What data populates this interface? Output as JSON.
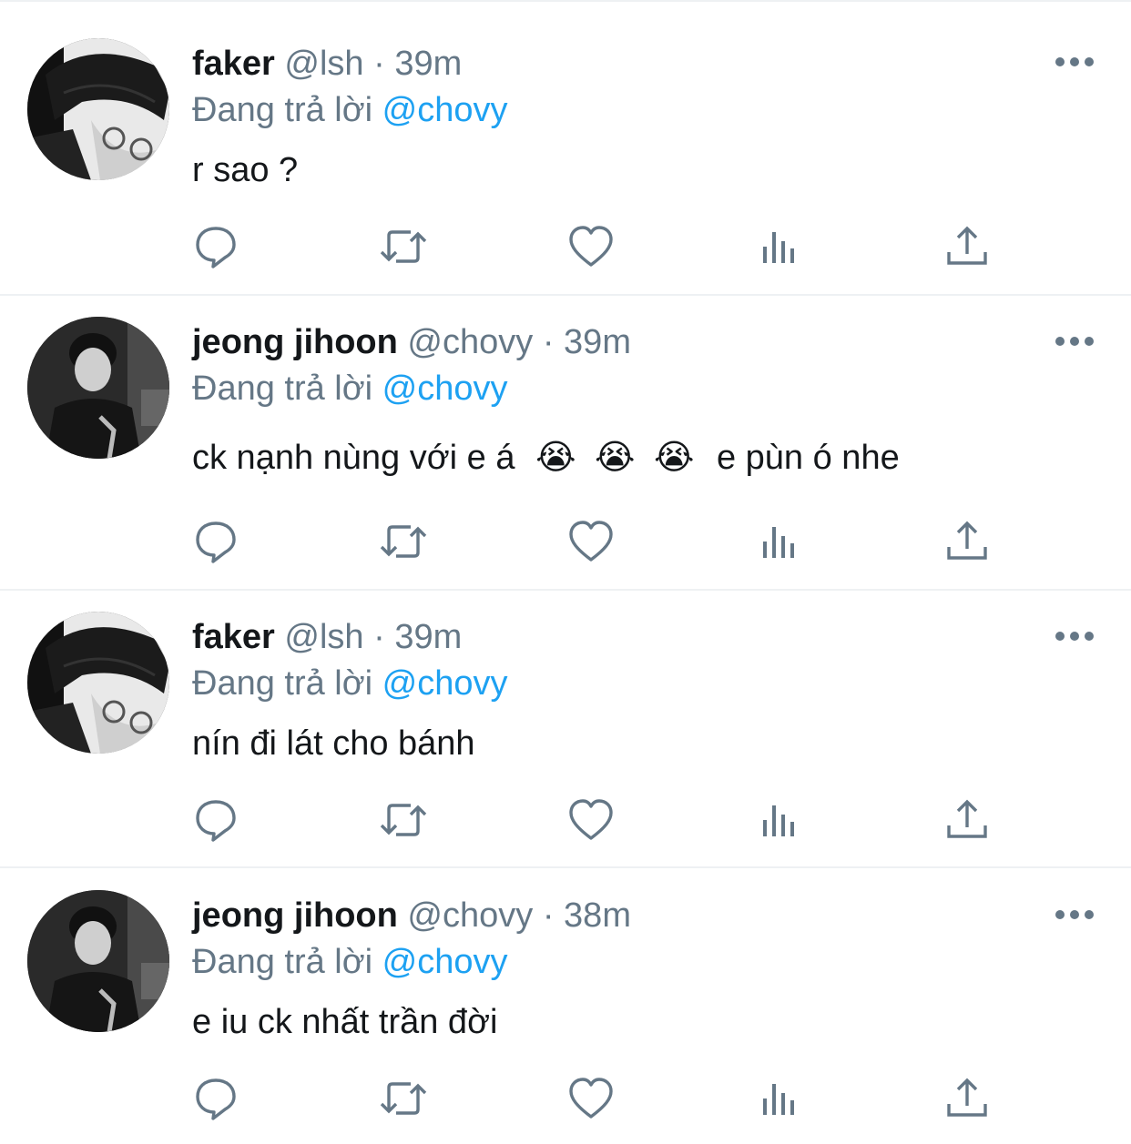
{
  "colors": {
    "text": "#14171a",
    "secondary": "#657786",
    "mention": "#1da1f2",
    "divider": "#e8ecef"
  },
  "icons": {
    "more": "more-horizontal-icon",
    "reply": "reply-icon",
    "retweet": "retweet-icon",
    "like": "heart-icon",
    "analytics": "analytics-icon",
    "share": "share-icon"
  },
  "tweets": [
    {
      "name": "faker",
      "handle": "@lsh",
      "separator": "·",
      "time": "39m",
      "reply_prefix": "Đang trả lời",
      "reply_to": "@chovy",
      "text": "r sao ?",
      "avatar": "faker-avatar"
    },
    {
      "name": "jeong jihoon",
      "handle": "@chovy",
      "separator": "·",
      "time": "39m",
      "reply_prefix": "Đang trả lời",
      "reply_to": "@chovy",
      "text_before_emoji": "ck nạnh nùng với e á",
      "emoji": [
        "😭",
        "😭",
        "😭"
      ],
      "text_after_emoji": "e pùn ó nhe",
      "avatar": "chovy-avatar"
    },
    {
      "name": "faker",
      "handle": "@lsh",
      "separator": "·",
      "time": "39m",
      "reply_prefix": "Đang trả lời",
      "reply_to": "@chovy",
      "text": "nín đi lát cho bánh",
      "avatar": "faker-avatar"
    },
    {
      "name": "jeong jihoon",
      "handle": "@chovy",
      "separator": "·",
      "time": "38m",
      "reply_prefix": "Đang trả lời",
      "reply_to": "@chovy",
      "text": "e iu ck nhất trần đời",
      "avatar": "chovy-avatar"
    }
  ]
}
